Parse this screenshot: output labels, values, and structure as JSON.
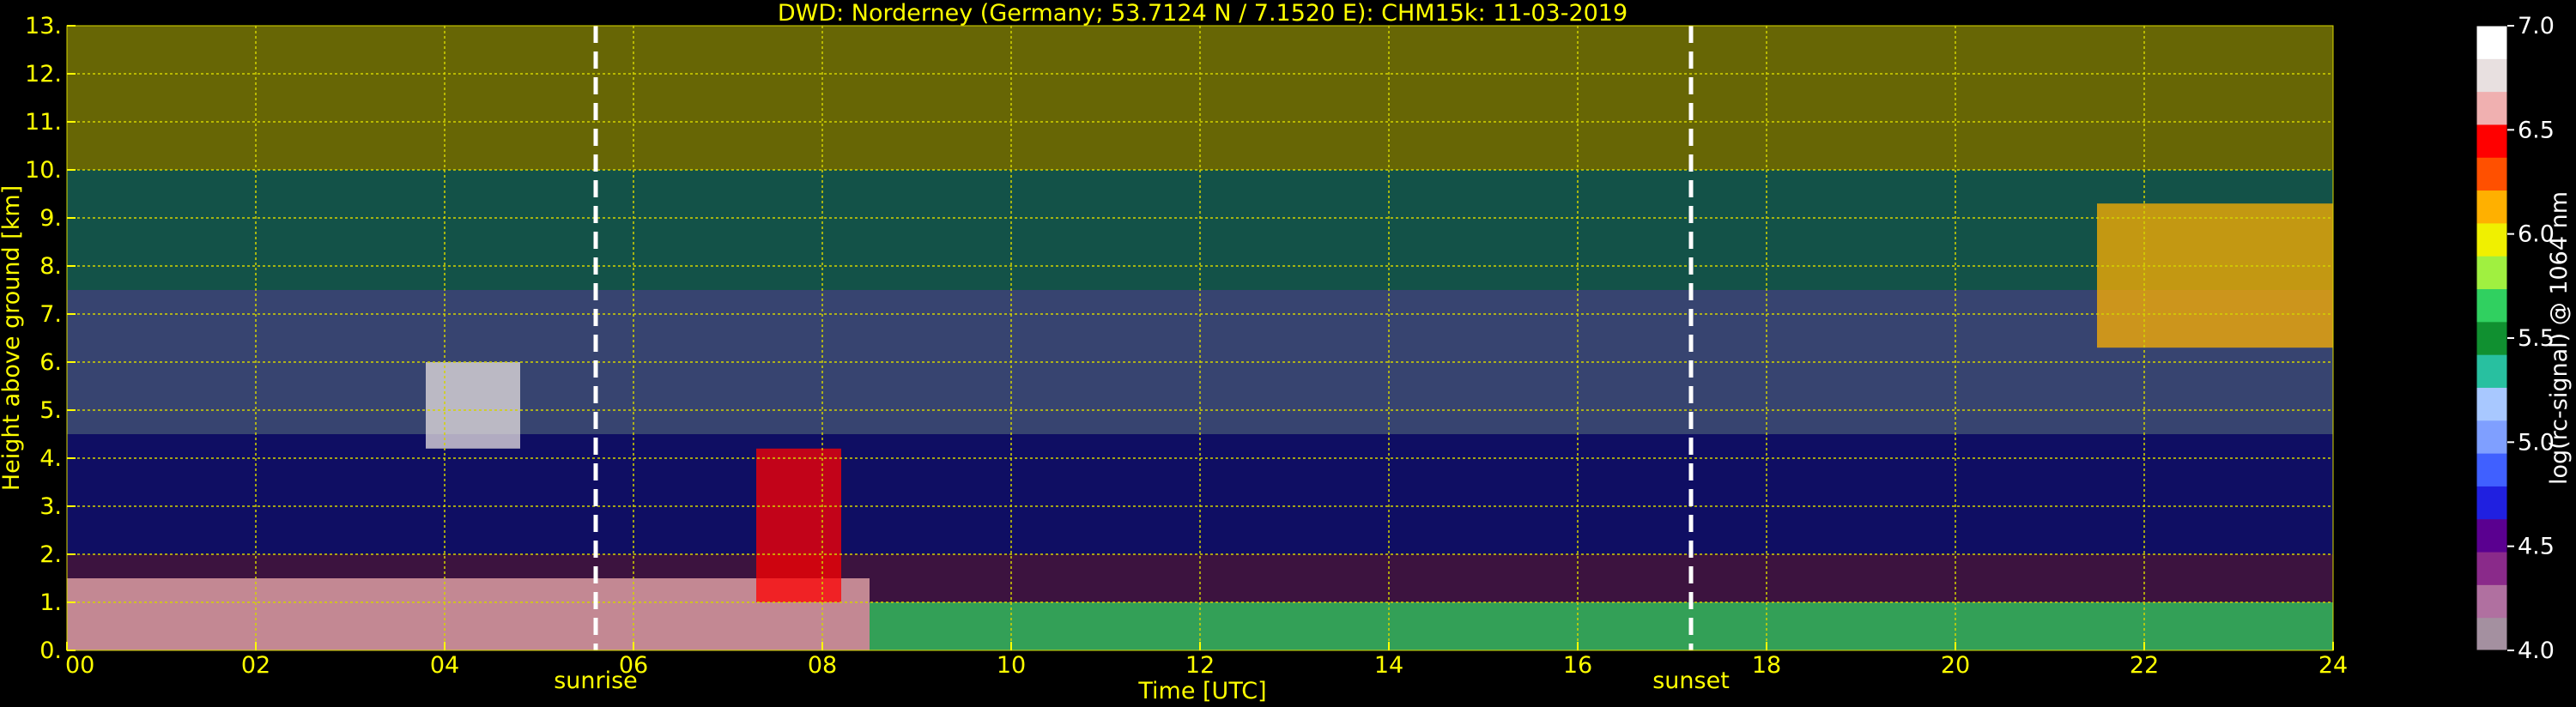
{
  "chart_data": {
    "type": "heatmap",
    "title": "DWD: Norderney (Germany; 53.7124 N / 7.1520 E):    CHM15k: 11-03-2019",
    "xlabel": "Time [UTC]",
    "ylabel": "Height above ground [km]",
    "colorbar_label": "log(rc-signal) @ 1064 nm",
    "xlim": [
      0,
      24
    ],
    "ylim": [
      0,
      13
    ],
    "x_ticks": [
      0,
      2,
      4,
      6,
      8,
      10,
      12,
      14,
      16,
      18,
      20,
      22,
      24
    ],
    "x_tick_labels": [
      "00",
      "02",
      "04",
      "06",
      "08",
      "10",
      "12",
      "14",
      "16",
      "18",
      "20",
      "22",
      "24"
    ],
    "y_ticks": [
      0,
      1,
      2,
      3,
      4,
      5,
      6,
      7,
      8,
      9,
      10,
      11,
      12,
      13
    ],
    "y_tick_labels": [
      "0.",
      "1.",
      "2.",
      "3.",
      "4.",
      "5.",
      "6.",
      "7.",
      "8.",
      "9.",
      "10.",
      "11.",
      "12.",
      "13."
    ],
    "colorbar_range": [
      4.0,
      7.0
    ],
    "colorbar_ticks": [
      4.0,
      4.5,
      5.0,
      5.5,
      6.0,
      6.5,
      7.0
    ],
    "colorbar_tick_labels": [
      "4.0",
      "4.5",
      "5.0",
      "5.5",
      "6.0",
      "6.5",
      "7.0"
    ],
    "grid": true,
    "markers": [
      {
        "label": "sunrise",
        "time": 5.6
      },
      {
        "label": "sunset",
        "time": 17.2
      }
    ],
    "layers": [
      {
        "time_start": 0,
        "time_end": 8.5,
        "height_top": 1.5,
        "signal": 6.6
      },
      {
        "time_start": 3.8,
        "time_end": 4.8,
        "height_bottom": 4.2,
        "height_top": 6.0,
        "signal": 6.8
      },
      {
        "time_start": 7.3,
        "time_end": 8.2,
        "height_bottom": 1.0,
        "height_top": 4.2,
        "signal": 6.5
      },
      {
        "time_start": 8.5,
        "time_end": 24,
        "height_top": 1.0,
        "signal": 5.6
      },
      {
        "time_start": 21.5,
        "time_end": 24,
        "height_bottom": 6.3,
        "height_top": 9.3,
        "signal": 6.2
      }
    ],
    "colors": {
      "axis_text": "#ffff00",
      "marker_line": "#ffffff",
      "background": "#000000",
      "grid": "#d4d400"
    },
    "colormap": [
      "#a490a0",
      "#b070a0",
      "#8a2a8a",
      "#5a0090",
      "#2020e0",
      "#4060ff",
      "#7f9fff",
      "#a8c8ff",
      "#28c0a0",
      "#109030",
      "#30d060",
      "#a0f040",
      "#f0f000",
      "#ffb000",
      "#ff5000",
      "#ff0000",
      "#f0b0b0",
      "#e8e0e0",
      "#ffffff"
    ]
  }
}
